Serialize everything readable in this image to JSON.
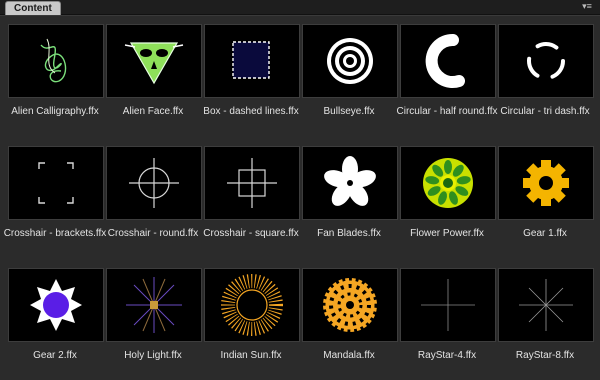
{
  "panel": {
    "tab_label": "Content",
    "menu_icon": "panel-menu-icon"
  },
  "items": [
    {
      "label": "Alien Calligraphy.ffx",
      "icon": "alien-calligraphy-thumbnail"
    },
    {
      "label": "Alien Face.ffx",
      "icon": "alien-face-thumbnail"
    },
    {
      "label": "Box - dashed lines.ffx",
      "icon": "box-dashed-thumbnail"
    },
    {
      "label": "Bullseye.ffx",
      "icon": "bullseye-thumbnail"
    },
    {
      "label": "Circular - half round.ffx",
      "icon": "circular-half-round-thumbnail"
    },
    {
      "label": "Circular - tri dash.ffx",
      "icon": "circular-tri-dash-thumbnail"
    },
    {
      "label": "Crosshair - brackets.ffx",
      "icon": "crosshair-brackets-thumbnail"
    },
    {
      "label": "Crosshair - round.ffx",
      "icon": "crosshair-round-thumbnail"
    },
    {
      "label": "Crosshair - square.ffx",
      "icon": "crosshair-square-thumbnail"
    },
    {
      "label": "Fan Blades.ffx",
      "icon": "fan-blades-thumbnail"
    },
    {
      "label": "Flower Power.ffx",
      "icon": "flower-power-thumbnail"
    },
    {
      "label": "Gear 1.ffx",
      "icon": "gear-1-thumbnail"
    },
    {
      "label": "Gear 2.ffx",
      "icon": "gear-2-thumbnail"
    },
    {
      "label": "Holy Light.ffx",
      "icon": "holy-light-thumbnail"
    },
    {
      "label": "Indian Sun.ffx",
      "icon": "indian-sun-thumbnail"
    },
    {
      "label": "Mandala.ffx",
      "icon": "mandala-thumbnail"
    },
    {
      "label": "RayStar-4.ffx",
      "icon": "raystar-4-thumbnail"
    },
    {
      "label": "RayStar-8.ffx",
      "icon": "raystar-8-thumbnail"
    }
  ],
  "colors": {
    "panel_bg": "#2b2b2b",
    "thumb_bg": "#000000",
    "alien_green": "#8ee05a",
    "flower_green": "#c8e000",
    "gear_yellow": "#f4b400",
    "gear2_purple": "#5a1ee6",
    "mandala_orange": "#f5a623"
  }
}
